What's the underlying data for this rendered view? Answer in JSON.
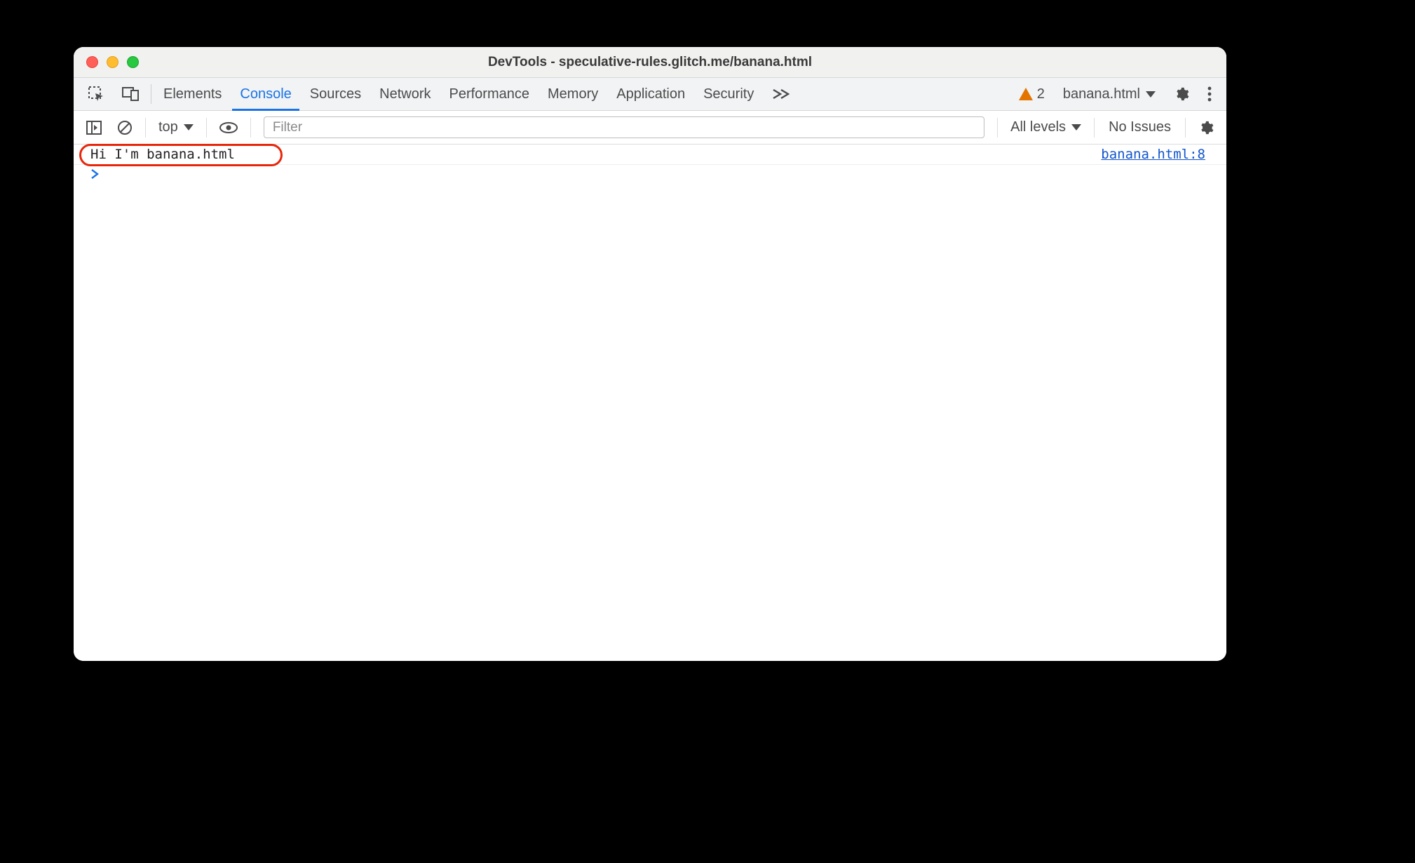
{
  "window": {
    "title": "DevTools - speculative-rules.glitch.me/banana.html"
  },
  "tabs": {
    "items": [
      "Elements",
      "Console",
      "Sources",
      "Network",
      "Performance",
      "Memory",
      "Application",
      "Security"
    ],
    "active_index": 1,
    "warning_count": "2",
    "context_label": "banana.html"
  },
  "filterbar": {
    "context": "top",
    "filter_placeholder": "Filter",
    "levels_label": "All levels",
    "issues_label": "No Issues"
  },
  "console": {
    "rows": [
      {
        "message": "Hi I'm banana.html",
        "source": "banana.html:8"
      }
    ],
    "prompt": "›"
  }
}
